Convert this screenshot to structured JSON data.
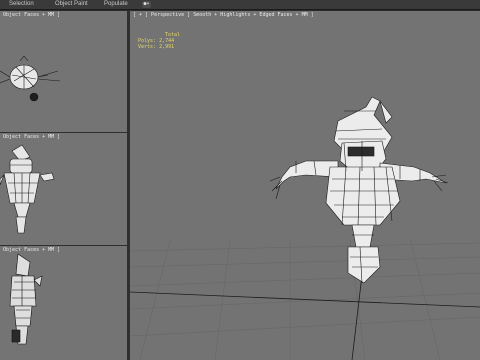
{
  "menu": {
    "items": [
      "Selection",
      "Object Paint",
      "Populate"
    ]
  },
  "viewports": {
    "top": {
      "label": "Object Faces + MM ]"
    },
    "front": {
      "label": "Object Faces + MM ]"
    },
    "left": {
      "label": "Object Faces + MM ]"
    },
    "perspective": {
      "label": "[ + ] Perspective ] Smooth + Highlights + Edged Faces + MM ]"
    }
  },
  "stats": {
    "title": "Total",
    "polys": "Polys: 2,744",
    "verts": "Verts: 2,991"
  },
  "icons": {
    "viewport_toggle": "eye-icon"
  }
}
